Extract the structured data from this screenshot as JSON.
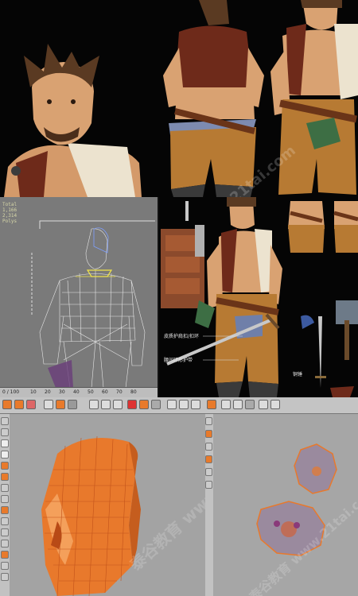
{
  "viewport": {
    "stats": [
      "Total",
      "1,166",
      "2,314",
      "Polys"
    ],
    "time": [
      "0 / 100",
      "10",
      "20",
      "30",
      "40",
      "50",
      "60",
      "70",
      "80"
    ]
  },
  "reference": {
    "callouts": [
      "皮质护肩扣/扣环",
      "腰间环形护带",
      "铜锤"
    ]
  },
  "watermark": {
    "top": "www.21tai.com",
    "mid": "泰谷教育 www.21tai.com",
    "bottom": "泰谷教育 www.21tai.com"
  },
  "colors": {
    "skin": "#d9a272",
    "hair": "#5a3a22",
    "vest": "#6e2a1a",
    "pants": "#b77a33",
    "mesh_orange": "#e8792c",
    "viewport_gray": "#7a7a7a"
  }
}
